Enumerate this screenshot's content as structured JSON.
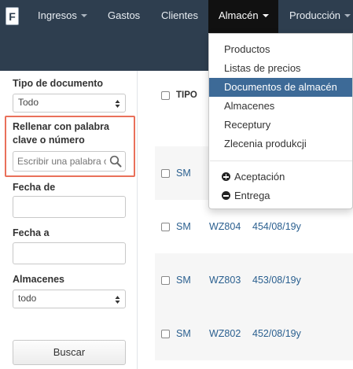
{
  "navbar": {
    "logo_letter": "F",
    "items": [
      {
        "label": "Ingresos",
        "has_caret": true
      },
      {
        "label": "Gastos",
        "has_caret": false
      },
      {
        "label": "Clientes",
        "has_caret": false
      },
      {
        "label": "Almacén",
        "has_caret": true,
        "active": true
      },
      {
        "label": "Producción",
        "has_caret": true
      }
    ]
  },
  "sidebar": {
    "doc_type_label": "Tipo de documento",
    "doc_type_value": "Todo",
    "keyword_label_line1": "Rellenar con palabra",
    "keyword_label_line2": "clave o número",
    "keyword_placeholder": "Escribir una palabra o",
    "date_from_label": "Fecha de",
    "date_to_label": "Fecha a",
    "warehouses_label": "Almacenes",
    "warehouses_value": "todo",
    "search_button": "Buscar"
  },
  "table": {
    "header_type": "TIPO",
    "rows": [
      {
        "type": "SM",
        "code": "",
        "number": ""
      },
      {
        "type": "SM",
        "code": "WZ804",
        "number": "454/08/19y"
      },
      {
        "type": "SM",
        "code": "WZ803",
        "number": "453/08/19y"
      },
      {
        "type": "SM",
        "code": "WZ802",
        "number": "452/08/19y"
      }
    ]
  },
  "dropdown": {
    "items": [
      {
        "label": "Productos"
      },
      {
        "label": "Listas de precios"
      },
      {
        "label": "Documentos de almacén",
        "selected": true
      },
      {
        "label": "Almacenes"
      },
      {
        "label": "Receptury"
      },
      {
        "label": "Zlecenia produkcji"
      }
    ],
    "actions": [
      {
        "label": "Aceptación",
        "icon": "plus-circle-icon"
      },
      {
        "label": "Entrega",
        "icon": "minus-circle-icon"
      }
    ]
  },
  "colors": {
    "navbar": "#2e3e4f",
    "active_nav": "#111111",
    "selected_item": "#3d6a97",
    "highlight_border": "#e9705a",
    "link": "#2a5f8f"
  }
}
